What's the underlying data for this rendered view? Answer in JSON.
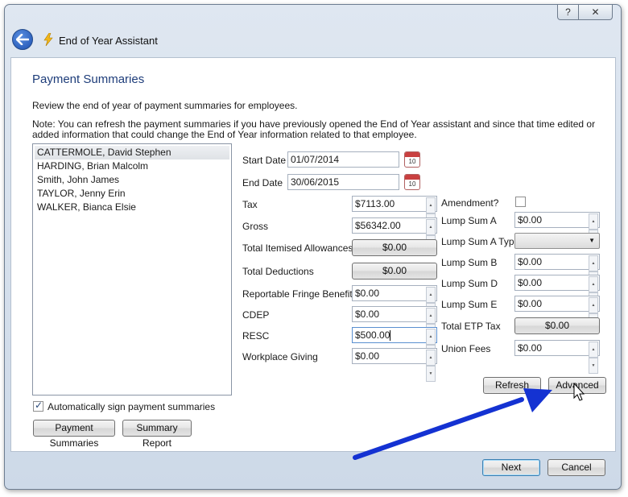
{
  "window": {
    "title": "End of Year Assistant",
    "help_glyph": "?",
    "close_glyph": "✕"
  },
  "page": {
    "title": "Payment Summaries",
    "description": "Review the end of year of payment summaries for employees.",
    "note": "Note: You can refresh the payment summaries if you have previously opened the End of Year assistant and since that time edited or added information that could change the End of Year information related to that employee."
  },
  "employees": [
    "CATTERMOLE, David Stephen",
    "HARDING, Brian Malcolm",
    "Smith, John James",
    "TAYLOR, Jenny Erin",
    "WALKER, Bianca Elsie"
  ],
  "selected_employee_index": 0,
  "dates": {
    "start_label": "Start Date",
    "start_value": "01/07/2014",
    "end_label": "End Date",
    "end_value": "30/06/2015",
    "calendar_num": "10"
  },
  "left_fields": {
    "tax_label": "Tax",
    "tax_value": "$7113.00",
    "gross_label": "Gross",
    "gross_value": "$56342.00",
    "allowances_label": "Total Itemised Allowances",
    "allowances_value": "$0.00",
    "deductions_label": "Total Deductions",
    "deductions_value": "$0.00",
    "rfb_label": "Reportable Fringe Benefits",
    "rfb_value": "$0.00",
    "cdep_label": "CDEP",
    "cdep_value": "$0.00",
    "resc_label": "RESC",
    "resc_value": "$500.00",
    "workplace_label": "Workplace Giving",
    "workplace_value": "$0.00"
  },
  "right_fields": {
    "amendment_label": "Amendment?",
    "amendment_checked": false,
    "lump_a_label": "Lump Sum A",
    "lump_a_value": "$0.00",
    "lump_a_type_label": "Lump Sum A Type",
    "lump_a_type_value": "",
    "lump_b_label": "Lump Sum B",
    "lump_b_value": "$0.00",
    "lump_d_label": "Lump Sum D",
    "lump_d_value": "$0.00",
    "lump_e_label": "Lump Sum E",
    "lump_e_value": "$0.00",
    "etp_label": "Total ETP Tax",
    "etp_value": "$0.00",
    "union_label": "Union Fees",
    "union_value": "$0.00"
  },
  "buttons": {
    "refresh": "Refresh",
    "advanced": "Advanced",
    "payment_summaries": "Payment Summaries",
    "summary_report": "Summary Report",
    "next": "Next",
    "cancel": "Cancel"
  },
  "auto_sign": {
    "label": "Automatically sign payment summaries",
    "checked": true
  },
  "colors": {
    "annotation_arrow": "#1432d2",
    "title_blue": "#1e3d7a"
  }
}
